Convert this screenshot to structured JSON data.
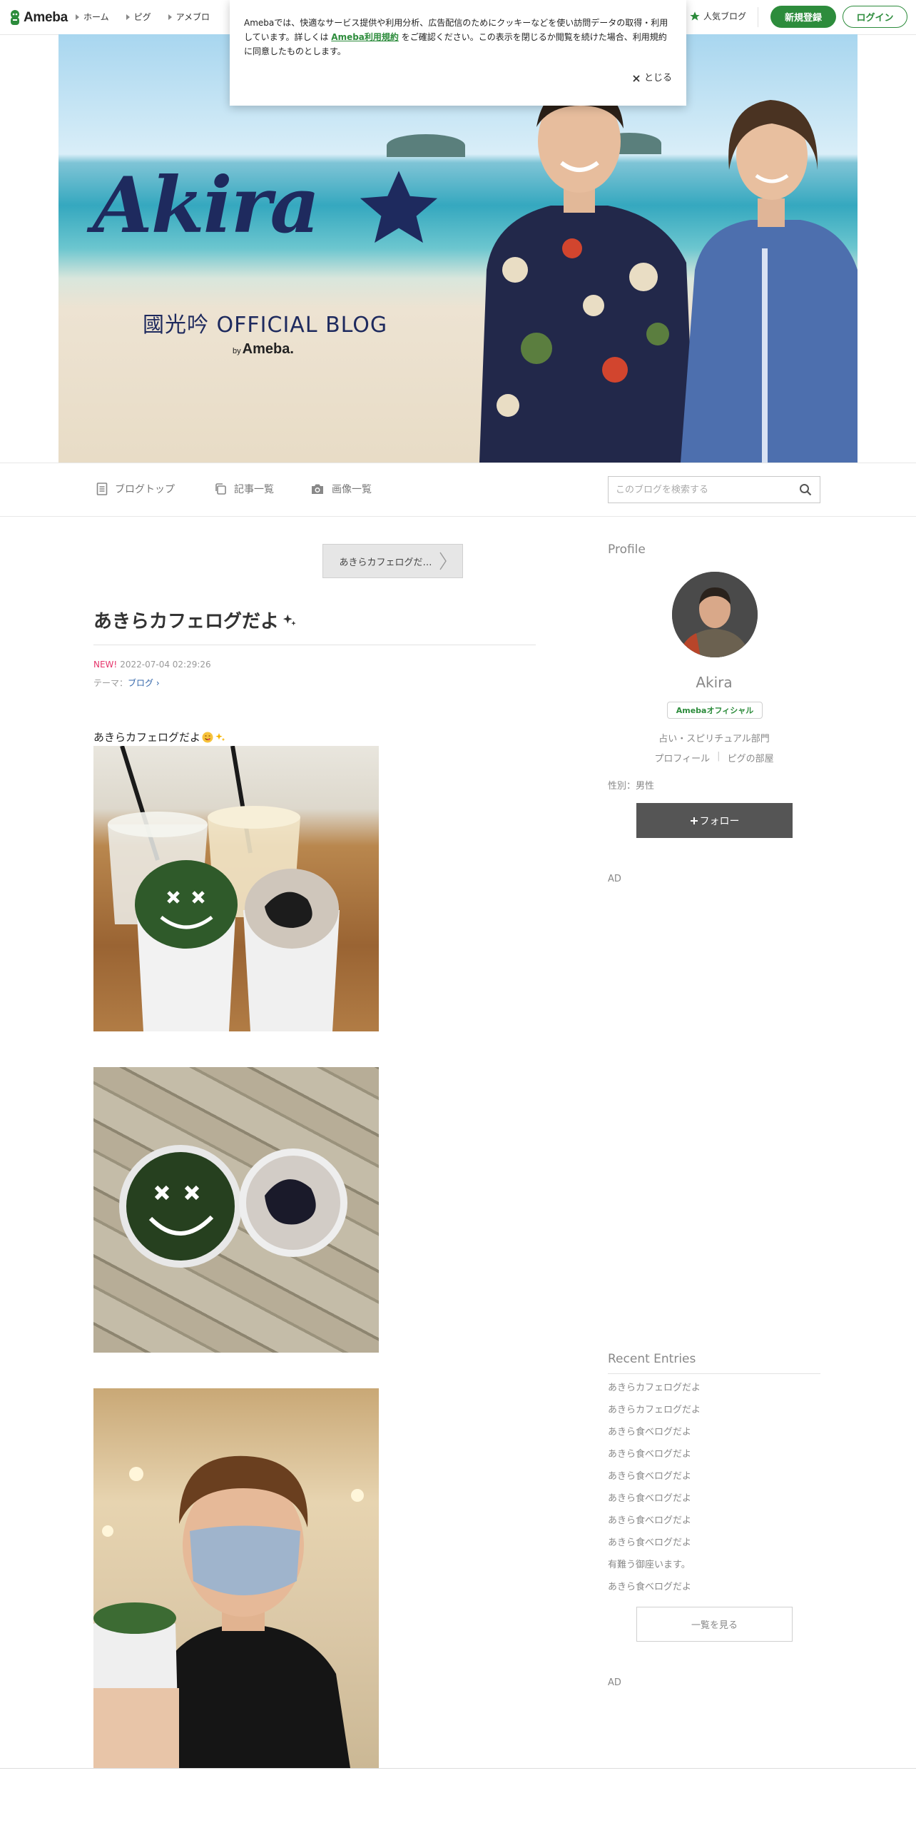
{
  "topbar": {
    "logo_text": "Ameba",
    "nav": [
      {
        "label": "ホーム"
      },
      {
        "label": "ピグ"
      },
      {
        "label": "アメブロ"
      }
    ],
    "popular_label": "人気ブログ",
    "register_label": "新規登録",
    "login_label": "ログイン"
  },
  "cookie": {
    "text_before": "Amebaでは、快適なサービス提供や利用分析、広告配信のためにクッキーなどを使い訪問データの取得・利用しています。詳しくは",
    "link_text": "Ameba利用規約",
    "text_after": "をご確認ください。この表示を閉じるか閲覧を続けた場合、利用規約に同意したものとします。",
    "close_label": "とじる"
  },
  "banner": {
    "title_script": "Akira",
    "subtitle": "國光吟 OFFICIAL BLOG",
    "by_small": "by",
    "by_brand": "Ameba."
  },
  "blognav": {
    "items": [
      {
        "label": "ブログトップ"
      },
      {
        "label": "記事一覧"
      },
      {
        "label": "画像一覧"
      }
    ],
    "search_placeholder": "このブログを検索する"
  },
  "article": {
    "prev_label": "あきらカフェログだ…",
    "title": "あきらカフェログだよ",
    "new_badge": "NEW!",
    "date": "2022-07-04 02:29:26",
    "theme_prefix": "テーマ：",
    "theme_link": "ブログ",
    "body_text": "あきらカフェログだよ"
  },
  "sidebar": {
    "profile_heading": "Profile",
    "name": "Akira",
    "official_badge": "Amebaオフィシャル",
    "category": "占い・スピリチュアル部門",
    "link_profile": "プロフィール",
    "link_pig_room": "ピグの部屋",
    "gender": "性別：男性",
    "follow_label": "フォロー",
    "ad_label": "AD",
    "recent_heading": "Recent Entries",
    "recent_entries": [
      {
        "title": "あきらカフェログだよ"
      },
      {
        "title": "あきらカフェログだよ"
      },
      {
        "title": "あきら食べログだよ"
      },
      {
        "title": "あきら食べログだよ"
      },
      {
        "title": "あきら食べログだよ"
      },
      {
        "title": "あきら食べログだよ"
      },
      {
        "title": "あきら食べログだよ"
      },
      {
        "title": "あきら食べログだよ"
      },
      {
        "title": "有難う御座います。"
      },
      {
        "title": "あきら食べログだよ"
      }
    ],
    "more_label": "一覧を見る",
    "ad_label_2": "AD"
  },
  "colors": {
    "brand_green": "#2d8c3c",
    "new_pink": "#e5356b",
    "theme_link_blue": "#3366aa",
    "follow_bg": "#555555"
  }
}
